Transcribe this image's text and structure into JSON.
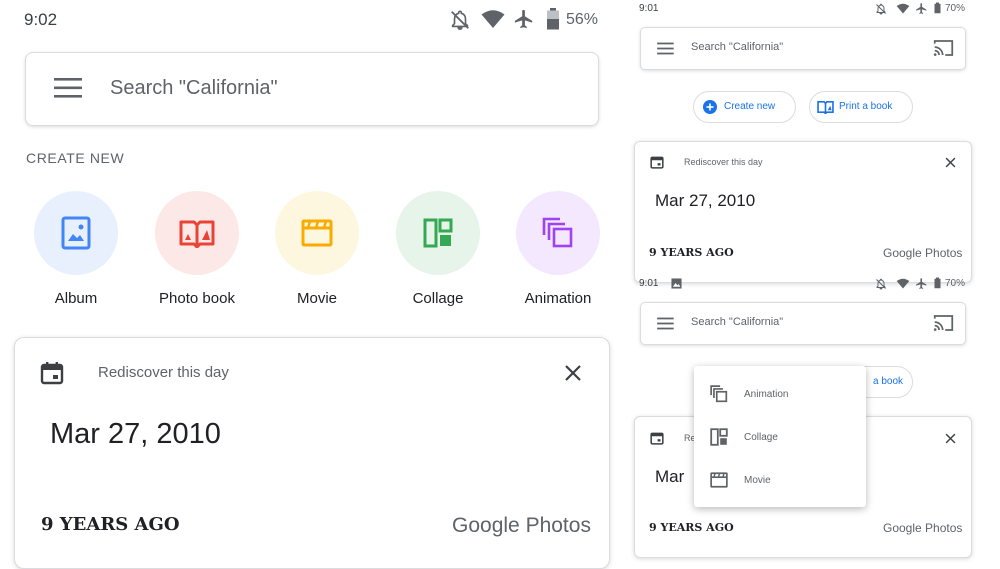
{
  "colors": {
    "accent": "#1a73e8",
    "album": "#e8f0fe",
    "photo_book": "#fce8e6",
    "movie": "#fef7e0",
    "collage": "#e6f4ea",
    "animation": "#f3e8fd"
  },
  "left": {
    "status": {
      "time": "9:02",
      "battery": "56%",
      "icons": [
        "bell-off-icon",
        "wifi-icon",
        "airplane-icon",
        "battery-icon"
      ]
    },
    "search": {
      "placeholder": "Search \"California\"",
      "icon": "menu-icon"
    },
    "create": {
      "title": "CREATE NEW",
      "items": [
        {
          "label": "Album",
          "icon": "album-icon"
        },
        {
          "label": "Photo book",
          "icon": "photo-book-icon"
        },
        {
          "label": "Movie",
          "icon": "movie-icon"
        },
        {
          "label": "Collage",
          "icon": "collage-icon"
        },
        {
          "label": "Animation",
          "icon": "animation-icon"
        }
      ]
    },
    "card": {
      "title": "Rediscover this day",
      "date": "Mar 27, 2010",
      "years": "9 YEARS AGO",
      "brand_google": "Google",
      "brand_photos": "Photos"
    }
  },
  "right_top": {
    "status": {
      "time": "9:01",
      "battery": "70%"
    },
    "search": {
      "placeholder": "Search \"California\""
    },
    "chips": [
      {
        "label": "Create new",
        "icon": "add-circle-icon"
      },
      {
        "label": "Print a book",
        "icon": "book-icon"
      }
    ],
    "card": {
      "title": "Rediscover this day",
      "date": "Mar 27, 2010",
      "years": "9 YEARS AGO",
      "brand": "Google Photos"
    }
  },
  "right_bottom": {
    "status": {
      "time": "9:01",
      "battery": "70%"
    },
    "search": {
      "placeholder": "Search \"California\""
    },
    "chip_partial": "a book",
    "card": {
      "title_partial": "Re",
      "date_partial": "Mar",
      "years": "9 YEARS AGO",
      "brand": "Google Photos"
    },
    "menu": [
      {
        "label": "Animation",
        "icon": "animation-icon"
      },
      {
        "label": "Collage",
        "icon": "collage-icon"
      },
      {
        "label": "Movie",
        "icon": "movie-icon"
      }
    ]
  }
}
